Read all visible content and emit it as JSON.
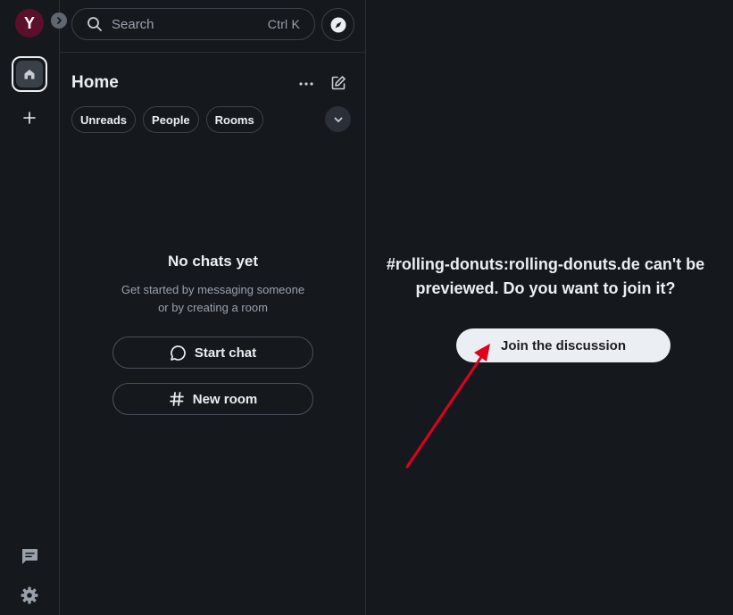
{
  "user": {
    "avatar_initial": "Y"
  },
  "rail": {
    "icons": [
      "chevron-right-icon",
      "home-icon",
      "plus-icon",
      "threads-icon",
      "gear-icon"
    ]
  },
  "search": {
    "placeholder": "Search",
    "shortcut": "Ctrl K"
  },
  "roomlist": {
    "title": "Home",
    "filters": [
      "Unreads",
      "People",
      "Rooms"
    ],
    "empty_title": "No chats yet",
    "empty_desc_line1": "Get started by messaging someone",
    "empty_desc_line2": "or by creating a room",
    "start_chat_label": "Start chat",
    "new_room_label": "New room"
  },
  "main": {
    "preview_line1": "#rolling-donuts:rolling-donuts.de can't be",
    "preview_line2": "previewed. Do you want to join it?",
    "join_label": "Join the discussion"
  },
  "colors": {
    "background": "#15191e",
    "avatar": "#5c0f2b",
    "text": "#ebeef2",
    "secondary_text": "#9aa1ab",
    "annotation_arrow": "#e0001b"
  }
}
